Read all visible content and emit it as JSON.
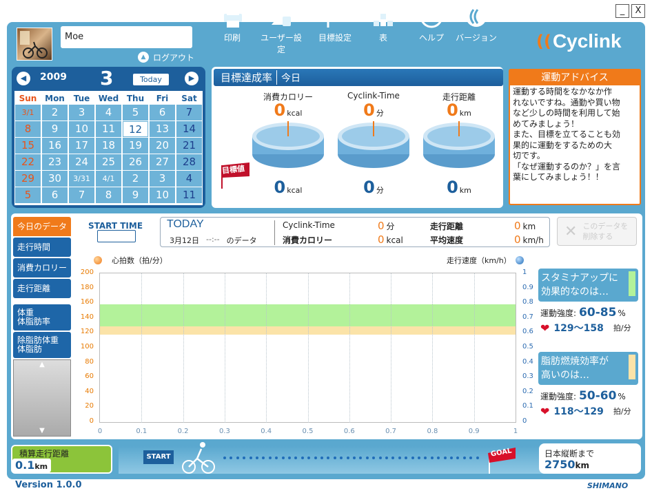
{
  "window": {
    "minimize": "_",
    "close": "X"
  },
  "user": {
    "name": "Moe",
    "logout": "ログアウト"
  },
  "nav": [
    {
      "label": "印刷",
      "icon": "printer-icon"
    },
    {
      "label": "ユーザー設定",
      "icon": "user-settings-icon"
    },
    {
      "label": "目標設定",
      "icon": "flag-icon"
    },
    {
      "label": "表",
      "icon": "table-icon"
    },
    {
      "label": "ヘルプ",
      "icon": "help-icon"
    },
    {
      "label": "バージョン",
      "icon": "version-icon"
    }
  ],
  "brand": {
    "logo": "Cyclink",
    "maker": "SHIMANO",
    "accent": "#f07a1a"
  },
  "calendar": {
    "year": "2009",
    "month": "3",
    "today_btn": "Today",
    "dow": [
      "Sun",
      "Mon",
      "Tue",
      "Wed",
      "Thu",
      "Fri",
      "Sat"
    ],
    "weeks": [
      [
        "3/1",
        "2",
        "3",
        "4",
        "5",
        "6",
        "7"
      ],
      [
        "8",
        "9",
        "10",
        "11",
        "12",
        "13",
        "14"
      ],
      [
        "15",
        "16",
        "17",
        "18",
        "19",
        "20",
        "21"
      ],
      [
        "22",
        "23",
        "24",
        "25",
        "26",
        "27",
        "28"
      ],
      [
        "29",
        "30",
        "3/31",
        "4/1",
        "2",
        "3",
        "4"
      ],
      [
        "5",
        "6",
        "7",
        "8",
        "9",
        "10",
        "11"
      ]
    ],
    "selected": "12"
  },
  "goal": {
    "title": "目標達成率",
    "subtitle": "今日",
    "flag_label": "目標値",
    "metrics": [
      {
        "label": "消費カロリー",
        "value": "0",
        "unit": "kcal",
        "target": "0",
        "target_unit": "kcal"
      },
      {
        "label": "Cyclink-Time",
        "value": "0",
        "unit": "分",
        "target": "0",
        "target_unit": "分"
      },
      {
        "label": "走行距離",
        "value": "0",
        "unit": "km",
        "target": "0",
        "target_unit": "km"
      }
    ]
  },
  "advice": {
    "title": "運動アドバイス",
    "lines": [
      "運動する時間をなかなか作",
      "れないですね。通勤や買い物",
      "など少しの時間を利用して始",
      "めてみましょう！",
      "また、目標を立てることも効",
      "果的に運動をするための大",
      "切です。",
      "「なぜ運動するのか？」を言",
      "葉にしてみましょう！！"
    ]
  },
  "sidebar": {
    "items": [
      "今日のデータ",
      "走行時間",
      "消費カロリー",
      "走行距離"
    ],
    "body_items": [
      [
        "体重",
        "体脂肪率"
      ],
      [
        "除脂肪体重",
        "体脂肪"
      ]
    ]
  },
  "today": {
    "start_time_label": "START TIME",
    "start_time_value": "",
    "title": "TODAY",
    "date": "3月12日",
    "time": "--:--",
    "suffix": "のデータ",
    "stats": [
      {
        "label": "Cyclink-Time",
        "value": "0",
        "unit": "分"
      },
      {
        "label": "消費カロリー",
        "value": "0",
        "unit": "kcal"
      },
      {
        "label": "走行距離",
        "value": "0",
        "unit": "km"
      },
      {
        "label": "平均速度",
        "value": "0",
        "unit": "km/h"
      }
    ],
    "delete_btn": [
      "このデータを",
      "削除する"
    ]
  },
  "chart_data": {
    "type": "line",
    "left_axis_label": "心拍数（拍/分）",
    "right_axis_label": "走行速度（km/h）",
    "y_left": {
      "ticks": [
        "200",
        "180",
        "160",
        "140",
        "120",
        "100",
        "80",
        "60",
        "40",
        "20",
        "0"
      ],
      "range": [
        0,
        200
      ]
    },
    "y_right": {
      "ticks": [
        "1",
        "0.9",
        "0.8",
        "0.7",
        "0.6",
        "0.5",
        "0.4",
        "0.3",
        "0.2",
        "0.1",
        "0"
      ],
      "range": [
        0,
        1
      ]
    },
    "x": {
      "ticks": [
        "0",
        "0.1",
        "0.2",
        "0.3",
        "0.4",
        "0.5",
        "0.6",
        "0.7",
        "0.8",
        "0.9",
        "1"
      ],
      "range": [
        0,
        1
      ]
    },
    "bands": [
      {
        "name": "stamina",
        "from": 129,
        "to": 158,
        "color": "#b3f29a"
      },
      {
        "name": "fat-burn",
        "from": 118,
        "to": 129,
        "color": "#fbe3a8"
      }
    ],
    "series": [],
    "grid": true
  },
  "zones": [
    {
      "title": [
        "スタミナアップに",
        "効果的なのは…"
      ],
      "intensity_label": "運動強度:",
      "intensity": "60-85",
      "pct": "%",
      "hr": "129〜158",
      "hr_unit": "拍/分",
      "color": "#b3f29a"
    },
    {
      "title": [
        "脂肪燃焼効率が",
        "高いのは…"
      ],
      "intensity_label": "運動強度:",
      "intensity": "50-60",
      "pct": "%",
      "hr": "118〜129",
      "hr_unit": "拍/分",
      "color": "#fbe3a8"
    }
  ],
  "footer": {
    "total_label": "積算走行距離",
    "total_value": "0.1",
    "total_unit": "km",
    "start_sign": "START",
    "goal_sign": "GOAL",
    "remain_label": "日本縦断まで",
    "remain_value": "2750",
    "remain_unit": "km",
    "progress_fraction": 0.0,
    "version": "Version 1.0.0"
  }
}
